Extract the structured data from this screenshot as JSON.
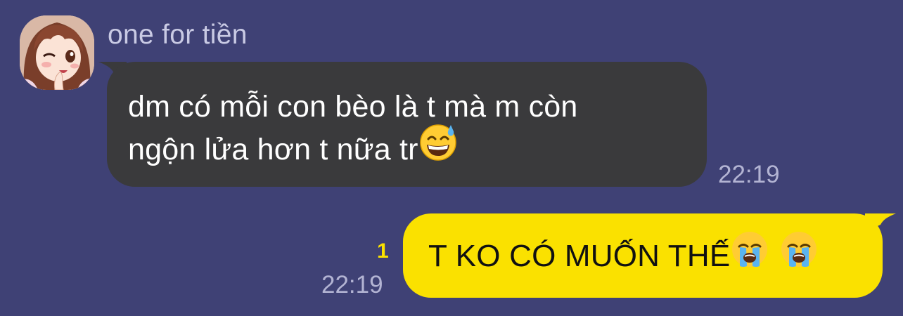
{
  "chat": {
    "incoming": {
      "sender_name": "one for tiền",
      "avatar_icon": "anime-girl-avatar-icon",
      "text_line1": "dm có mỗi con bèo là t mà m còn",
      "text_line2": "ngộn lửa hơn t nữa tr",
      "emoji": "grinning-face-with-sweat-icon",
      "time": "22:19",
      "bubble_color": "#3a3a3c"
    },
    "outgoing": {
      "text": "T KO CÓ MUỐN THẾ",
      "emojis": [
        "loudly-crying-face-icon",
        "loudly-crying-face-icon"
      ],
      "time": "22:19",
      "unread_count": "1",
      "bubble_color": "#fae100"
    },
    "background_color": "#3f4175"
  }
}
